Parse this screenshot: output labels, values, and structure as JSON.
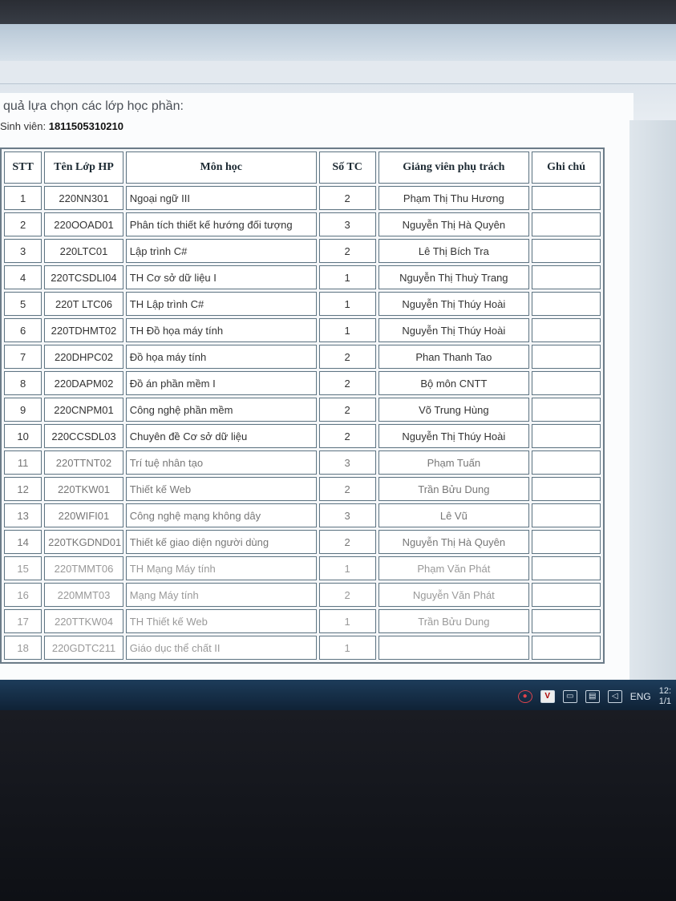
{
  "heading": "quả lựa chọn các lớp học phần:",
  "student": {
    "label": "Sinh viên:",
    "id": "1811505310210"
  },
  "table": {
    "headers": [
      "STT",
      "Tên Lớp HP",
      "Môn học",
      "Số TC",
      "Giảng viên phụ trách",
      "Ghi chú"
    ],
    "rows": [
      [
        "1",
        "220NN301",
        "Ngoại ngữ III",
        "2",
        "Phạm Thị Thu Hương",
        ""
      ],
      [
        "2",
        "220OOAD01",
        "Phân tích thiết kế hướng đối tượng",
        "3",
        "Nguyễn Thị Hà Quyên",
        ""
      ],
      [
        "3",
        "220LTC01",
        "Lập trình C#",
        "2",
        "Lê Thị Bích Tra",
        ""
      ],
      [
        "4",
        "220TCSDLI04",
        "TH Cơ sở dữ liệu I",
        "1",
        "Nguyễn Thị Thuỳ Trang",
        ""
      ],
      [
        "5",
        "220T LTC06",
        "TH Lập trình C#",
        "1",
        "Nguyễn Thị Thúy Hoài",
        ""
      ],
      [
        "6",
        "220TDHMT02",
        "TH Đồ họa máy tính",
        "1",
        "Nguyễn Thị Thúy Hoài",
        ""
      ],
      [
        "7",
        "220DHPC02",
        "Đồ họa máy tính",
        "2",
        "Phan Thanh Tao",
        ""
      ],
      [
        "8",
        "220DAPM02",
        "Đồ án phần mềm I",
        "2",
        "Bộ môn CNTT",
        ""
      ],
      [
        "9",
        "220CNPM01",
        "Công nghệ phần mềm",
        "2",
        "Võ Trung Hùng",
        ""
      ],
      [
        "10",
        "220CCSDL03",
        "Chuyên đề Cơ sở dữ liệu",
        "2",
        "Nguyễn Thị Thúy Hoài",
        ""
      ],
      [
        "11",
        "220TTNT02",
        "Trí tuệ nhân tạo",
        "3",
        "Phạm Tuấn",
        ""
      ],
      [
        "12",
        "220TKW01",
        "Thiết kế Web",
        "2",
        "Trần Bửu Dung",
        ""
      ],
      [
        "13",
        "220WIFI01",
        "Công nghệ mạng không dây",
        "3",
        "Lê Vũ",
        ""
      ],
      [
        "14",
        "220TKGDND01",
        "Thiết kế giao diện người dùng",
        "2",
        "Nguyễn Thị Hà Quyên",
        ""
      ],
      [
        "15",
        "220TMMT06",
        "TH Mạng Máy tính",
        "1",
        "Phạm Văn Phát",
        ""
      ],
      [
        "16",
        "220MMT03",
        "Mạng Máy tính",
        "2",
        "Nguyễn Văn Phát",
        ""
      ],
      [
        "17",
        "220TTKW04",
        "TH Thiết kế Web",
        "1",
        "Trần Bửu Dung",
        ""
      ],
      [
        "18",
        "220GDTC211",
        "Giáo dục thể chất II",
        "1",
        "",
        ""
      ]
    ]
  },
  "taskbar": {
    "tray_icons": [
      "antivirus-icon",
      "v-app-icon",
      "battery-icon",
      "network-icon",
      "volume-icon"
    ],
    "language": "ENG",
    "clock_time": "12:",
    "clock_date": "1/1"
  }
}
